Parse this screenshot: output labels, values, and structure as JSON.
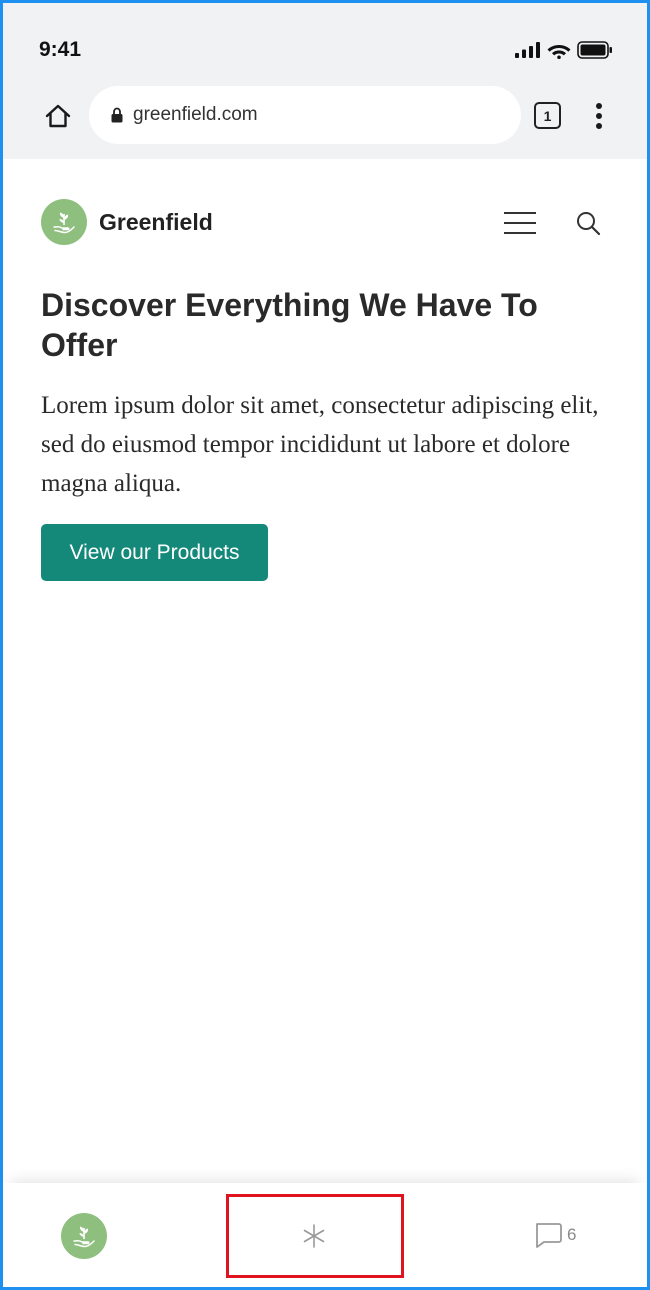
{
  "status_bar": {
    "time": "9:41",
    "icons": [
      "signal-icon",
      "wifi-icon",
      "battery-icon"
    ]
  },
  "browser": {
    "url": "greenfield.com",
    "tab_count": "1",
    "icons": [
      "home-icon",
      "lock-icon",
      "more-vert-icon"
    ]
  },
  "header": {
    "brand_name": "Greenfield",
    "icons": [
      "logo-icon",
      "hamburger-menu-icon",
      "search-icon"
    ]
  },
  "hero": {
    "title": "Discover Everything We Have To Offer",
    "body": "Lorem ipsum dolor sit amet, consectetur adipiscing elit, sed do eiusmod tempor incididunt ut labore et dolore magna aliqua.",
    "cta_label": "View our Products"
  },
  "bottom_bar": {
    "comment_count": "6",
    "icons": [
      "logo-icon",
      "sparkle-icon",
      "comment-icon"
    ]
  },
  "colors": {
    "accent": "#14897a",
    "logo_green": "#8fbf7f",
    "highlight": "#e0141e",
    "frame": "#1e90f0"
  }
}
